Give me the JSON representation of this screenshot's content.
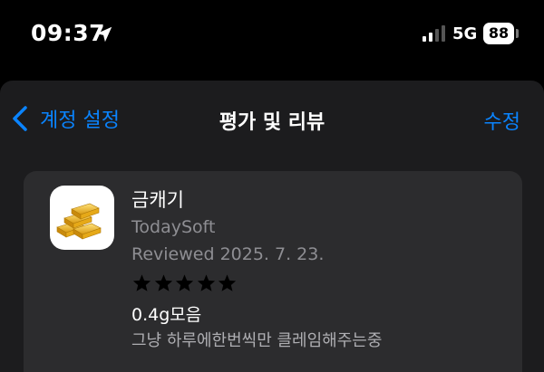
{
  "status_bar": {
    "time": "09:37",
    "network": "5G",
    "battery": "88",
    "location_icon": "location-arrow-icon",
    "signal_icon": "cellular-signal-icon"
  },
  "nav": {
    "back_label": "계정 설정",
    "title": "평가 및 리뷰",
    "edit_label": "수정"
  },
  "review": {
    "app_name": "금캐기",
    "developer": "TodaySoft",
    "reviewed_date": "Reviewed 2025. 7. 23.",
    "rating": 5,
    "title": "0.4g모음",
    "body": "그냥 하루에한번씩만 클레임해주는중",
    "app_icon": "gold-bars-icon"
  },
  "colors": {
    "accent": "#0a84ff",
    "background": "#000000",
    "sheet": "#1c1c1e",
    "card": "#2c2c2e",
    "secondary_text": "#8e8e93"
  }
}
